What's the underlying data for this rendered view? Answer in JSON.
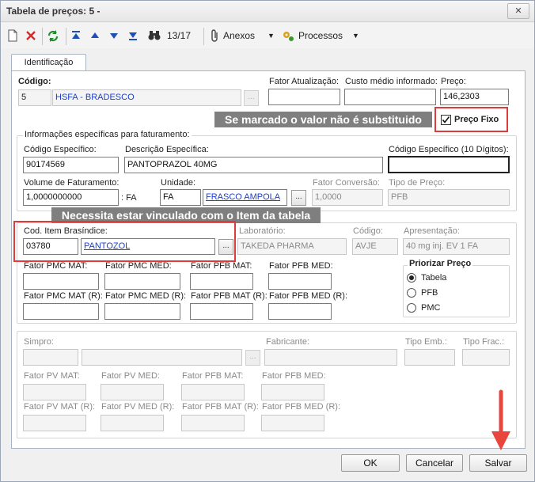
{
  "window": {
    "title": "Tabela de preços: 5 -",
    "close": "✕"
  },
  "toolbar": {
    "record_pos": "13/17",
    "anexos": "Anexos",
    "processos": "Processos"
  },
  "tabs": {
    "identificacao": "Identificação"
  },
  "form": {
    "codigo_label": "Código:",
    "codigo": "5",
    "descricao": "HSFA - BRADESCO",
    "fator_atualizacao_label": "Fator Atualização:",
    "custo_medio_label": "Custo médio informado:",
    "preco_label": "Preço:",
    "preco": "146,2303",
    "preco_fixo_label": "Preço Fixo",
    "preco_fixo_checked": true,
    "info_group_label": "Informações específicas para faturamento:",
    "cod_especifico_label": "Código Específico:",
    "cod_especifico": "90174569",
    "desc_especifica_label": "Descrição Específica:",
    "desc_especifica": "PANTOPRAZOL 40MG",
    "cod_esp10_label": "Código Específico (10 Dígitos):",
    "volume_label": "Volume de Faturamento:",
    "volume": "1,0000000000",
    "fa_suffix": ": FA",
    "unidade_label": "Unidade:",
    "unidade": "FA",
    "unidade_desc": "FRASCO AMPOLA",
    "fator_conversao_label": "Fator Conversão:",
    "fator_conversao": "1,0000",
    "tipo_preco_label": "Tipo de Preço:",
    "tipo_preco": "PFB",
    "cod_brasindice_label": "Cod. Item Brasíndice:",
    "cod_brasindice": "03780",
    "brasindice_desc": "PANTOZOL",
    "laboratorio_label": "Laboratório:",
    "laboratorio": "TAKEDA PHARMA",
    "codigo2_label": "Código:",
    "codigo2": "AVJE",
    "apresentacao_label": "Apresentação:",
    "apresentacao": "40 mg inj. EV 1 FA",
    "fator_pmc_mat": "Fator PMC MAT:",
    "fator_pmc_med": "Fator PMC MED:",
    "fator_pfb_mat": "Fator PFB MAT:",
    "fator_pfb_med": "Fator PFB MED:",
    "fator_pmc_mat_r": "Fator PMC MAT (R):",
    "fator_pmc_med_r": "Fator PMC MED (R):",
    "fator_pfb_mat_r": "Fator PFB MAT (R):",
    "fator_pfb_med_r": "Fator PFB MED (R):",
    "priorizar_label": "Priorizar Preço",
    "prior_tabela": "Tabela",
    "prior_pfb": "PFB",
    "prior_pmc": "PMC",
    "prior_selected": "Tabela",
    "simpro_label": "Simpro:",
    "fabricante_label": "Fabricante:",
    "tipo_emb_label": "Tipo Emb.:",
    "tipo_frac_label": "Tipo Frac.:",
    "fator_pv_mat": "Fator PV MAT:",
    "fator_pv_med": "Fator PV MED:",
    "fator_pfb_mat2": "Fator PFB MAT:",
    "fator_pfb_med2": "Fator PFB MED:",
    "fator_pv_mat_r": "Fator PV MAT (R):",
    "fator_pv_med_r": "Fator PV MED (R):",
    "fator_pfb_mat2_r": "Fator PFB MAT (R):",
    "fator_pfb_med2_r": "Fator PFB MED (R):"
  },
  "annotations": {
    "preco_fixo_note": "Se marcado o valor não é substituido",
    "brasindice_note": "Necessita estar vinculado com o Item da tabela"
  },
  "buttons": {
    "ok": "OK",
    "cancelar": "Cancelar",
    "salvar": "Salvar"
  },
  "colors": {
    "annotation_red": "#e03b3b",
    "arrow_red": "#e8463c",
    "link_blue": "#1a3fd0"
  }
}
